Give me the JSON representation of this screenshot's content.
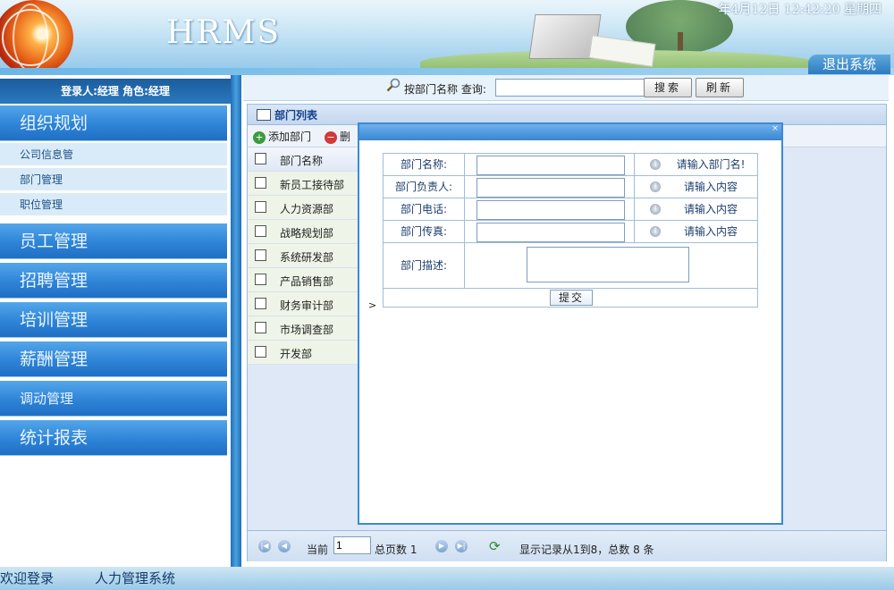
{
  "header": {
    "logo_text": "HRMS",
    "datetime": "年4月12日 12:42:20 星期四",
    "logout_label": "退出系统"
  },
  "sidebar": {
    "user_info": "登录人:经理 角色:经理",
    "menu": [
      {
        "label": "组织规划"
      },
      {
        "label": "员工管理"
      },
      {
        "label": "招聘管理"
      },
      {
        "label": "培训管理"
      },
      {
        "label": "薪酬管理"
      },
      {
        "label": "调动管理"
      },
      {
        "label": "统计报表"
      }
    ],
    "submenu": [
      {
        "label": "公司信息管"
      },
      {
        "label": "部门管理"
      },
      {
        "label": "职位管理"
      }
    ]
  },
  "search": {
    "label": "按部门名称 查询:",
    "value": "",
    "search_label": "搜索",
    "refresh_label": "刷新"
  },
  "panel": {
    "title": "部门列表",
    "add_label": "添加部门",
    "delete_label": "删",
    "column_header": "部门名称",
    "rows": [
      "新员工接待部",
      "人力资源部",
      "战略规划部",
      "系统研发部",
      "产品销售部",
      "财务审计部",
      "市场调查部",
      "开发部"
    ]
  },
  "pager": {
    "current_label": "当前",
    "current_value": "1",
    "total_label": "总页数 1",
    "info": "显示记录从1到8，总数 8 条"
  },
  "dialog": {
    "fields": [
      {
        "label": "部门名称:",
        "hint": "请输入部门名!"
      },
      {
        "label": "部门负责人:",
        "hint": "请输入内容"
      },
      {
        "label": "部门电话:",
        "hint": "请输入内容"
      },
      {
        "label": "部门传真:",
        "hint": "请输入内容"
      }
    ],
    "desc_label": "部门描述:",
    "submit_label": "提交",
    "marker": ">"
  },
  "footer": {
    "welcome": "欢迎登录",
    "app_name": "人力管理系统"
  }
}
